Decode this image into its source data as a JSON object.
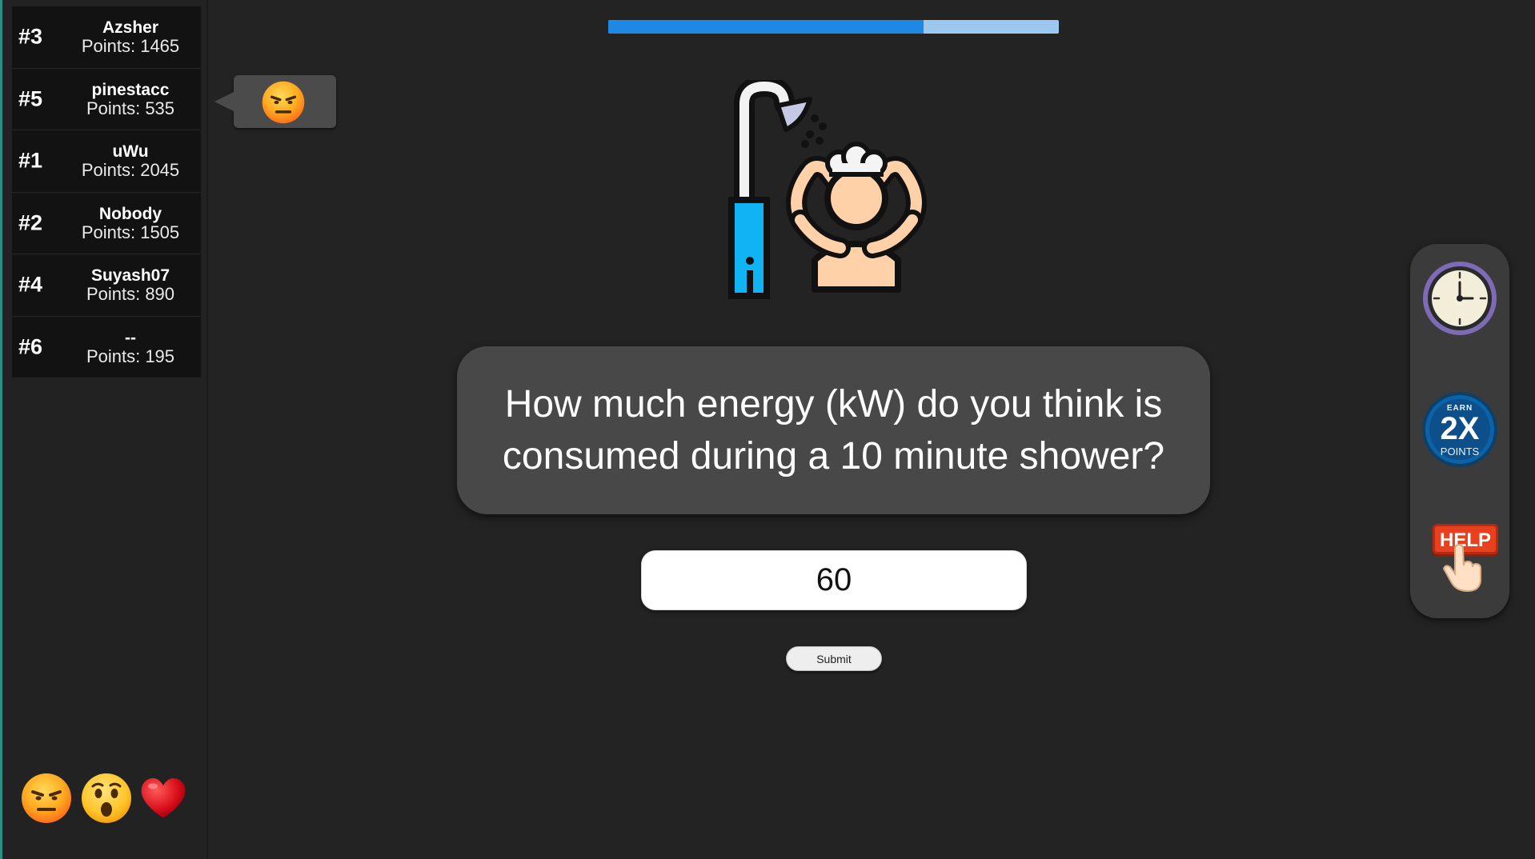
{
  "leaderboard": [
    {
      "rank": "#3",
      "name": "Azsher",
      "points": "Points: 1465"
    },
    {
      "rank": "#5",
      "name": "pinestacc",
      "points": "Points: 535"
    },
    {
      "rank": "#1",
      "name": "uWu",
      "points": "Points: 2045"
    },
    {
      "rank": "#2",
      "name": "Nobody",
      "points": "Points: 1505"
    },
    {
      "rank": "#4",
      "name": "Suyash07",
      "points": "Points: 890"
    },
    {
      "rank": "#6",
      "name": "--",
      "points": "Points: 195"
    }
  ],
  "progress": {
    "fraction": 0.7,
    "fill_color": "#1e88e5",
    "track_color": "#9cc8ef"
  },
  "question": {
    "illustration": "shower-icon",
    "text": "How much energy (kW) do you think is consumed during a 10 minute shower?"
  },
  "answer": {
    "value": "60"
  },
  "submit": {
    "label": "Submit"
  },
  "powerups": {
    "timer_icon": "clock-icon",
    "double_points": {
      "top": "EARN",
      "big": "2X",
      "bottom": "POINTS"
    },
    "help_label": "HELP"
  },
  "reactions": {
    "bubble_icon": "angry-face-icon",
    "tray": [
      "angry-face-icon",
      "surprised-face-icon",
      "heart-icon"
    ]
  }
}
